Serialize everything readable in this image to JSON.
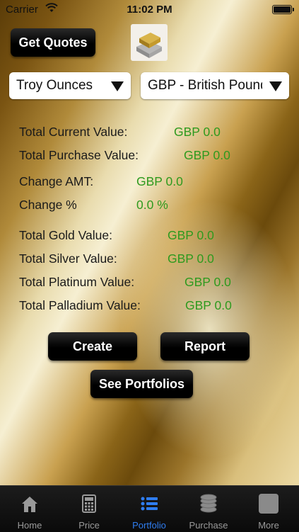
{
  "status_bar": {
    "carrier": "Carrier",
    "time": "11:02 PM"
  },
  "get_quotes_label": "Get Quotes",
  "unit_select": {
    "value": "Troy Ounces"
  },
  "currency_select": {
    "value": "GBP - British Pound"
  },
  "summary": {
    "total_current": {
      "label": "Total Current Value:",
      "value": "GBP 0.0"
    },
    "total_purchase": {
      "label": "Total Purchase Value:",
      "value": "GBP 0.0"
    },
    "change_amt": {
      "label": "Change AMT:",
      "value": "GBP 0.0"
    },
    "change_pct": {
      "label": "Change %",
      "value": "0.0 %"
    }
  },
  "metals": {
    "gold": {
      "label": "Total Gold Value:",
      "value": "GBP 0.0"
    },
    "silver": {
      "label": "Total Silver Value:",
      "value": "GBP 0.0"
    },
    "platinum": {
      "label": "Total Platinum Value:",
      "value": "GBP 0.0"
    },
    "palladium": {
      "label": "Total Palladium Value:",
      "value": "GBP 0.0"
    }
  },
  "buttons": {
    "create": "Create",
    "report": "Report",
    "see_portfolios": "See Portfolios"
  },
  "tabs": [
    {
      "label": "Home",
      "icon": "home-icon"
    },
    {
      "label": "Price",
      "icon": "calculator-icon"
    },
    {
      "label": "Portfolio",
      "icon": "list-icon"
    },
    {
      "label": "Purchase",
      "icon": "coins-icon"
    },
    {
      "label": "More",
      "icon": "more-icon"
    }
  ],
  "colors": {
    "value_green": "#2e9a1e",
    "active_tab": "#2f7df0"
  }
}
